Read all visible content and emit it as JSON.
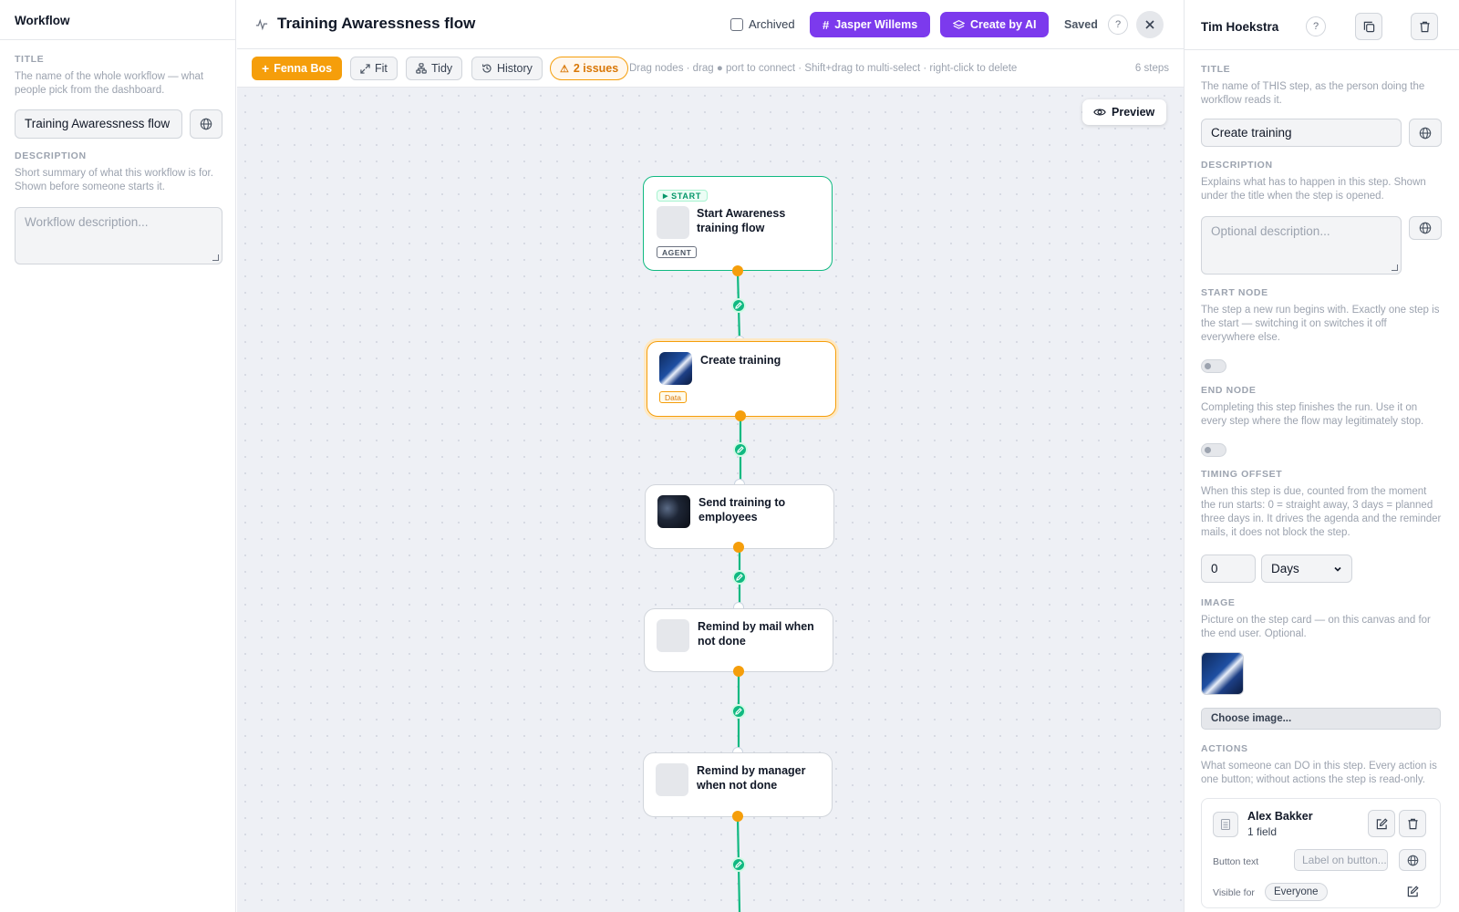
{
  "left_panel": {
    "header": "Workflow",
    "title_label": "TITLE",
    "title_help": "The name of the whole workflow — what people pick from the dashboard.",
    "title_value": "Training Awaressness flow",
    "description_label": "DESCRIPTION",
    "description_help": "Short summary of what this workflow is for. Shown before someone starts it.",
    "description_placeholder": "Workflow description..."
  },
  "topbar": {
    "title": "Training Awaressness flow",
    "archived_label": "Archived",
    "archived_checked": false,
    "user_button": "Jasper Willems",
    "ai_button": "Create by AI",
    "status": "Saved",
    "help": "?",
    "close_icon": "close-icon"
  },
  "toolbar": {
    "add_button": "Fenna Bos",
    "fit": "Fit",
    "tidy": "Tidy",
    "history": "History",
    "issues": "2 issues",
    "hint": "Drag nodes · drag ● port to connect · Shift+drag to multi-select · right-click to delete",
    "steps": "6 steps"
  },
  "canvas": {
    "preview_button": "Preview",
    "nodes": [
      {
        "title": "Start Awareness training flow",
        "start_badge": "START",
        "tag": "AGENT",
        "selected": false,
        "start": true
      },
      {
        "title": "Create training",
        "tag": "Data",
        "selected": true,
        "image": "training-image"
      },
      {
        "title": "Send training to employees",
        "image": "training-image-dark"
      },
      {
        "title": "Remind by mail when not done"
      },
      {
        "title": "Remind by manager when not done"
      }
    ],
    "colors": {
      "edge": "#10b981",
      "port": "#f59e0b",
      "selected": "#f59e0b",
      "start": "#10b981"
    }
  },
  "right_panel": {
    "header": "Tim Hoekstra",
    "help": "?",
    "title_label": "TITLE",
    "title_help": "The name of THIS step, as the person doing the workflow reads it.",
    "title_value": "Create training",
    "description_label": "DESCRIPTION",
    "description_help": "Explains what has to happen in this step. Shown under the title when the step is opened.",
    "description_placeholder": "Optional description...",
    "start_label": "START NODE",
    "start_help": "The step a new run begins with. Exactly one step is the start — switching it on switches it off everywhere else.",
    "start_on": false,
    "end_label": "END NODE",
    "end_help": "Completing this step finishes the run. Use it on every step where the flow may legitimately stop.",
    "end_on": false,
    "timing_label": "TIMING OFFSET",
    "timing_help": "When this step is due, counted from the moment the run starts: 0 = straight away, 3 days = planned three days in. It drives the agenda and the reminder mails, it does not block the step.",
    "timing_value": "0",
    "timing_unit": "Days",
    "image_label": "IMAGE",
    "image_help": "Picture on the step card — on this canvas and for the end user. Optional.",
    "choose_image": "Choose image...",
    "actions_label": "ACTIONS",
    "actions_help": "What someone can DO in this step. Every action is one button; without actions the step is read-only.",
    "action": {
      "name": "Alex Bakker",
      "fields": "1 field",
      "button_text_label": "Button text",
      "button_text_placeholder": "Label on button...",
      "visible_label": "Visible for",
      "visible_value": "Everyone"
    }
  }
}
